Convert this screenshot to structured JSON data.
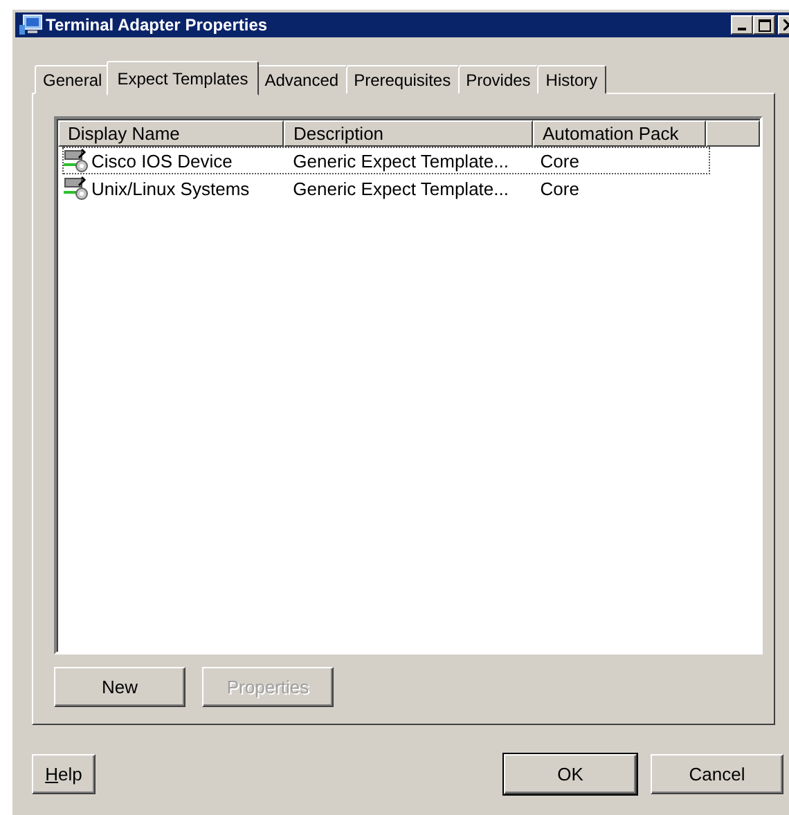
{
  "window": {
    "title": "Terminal Adapter Properties"
  },
  "tabs": [
    {
      "label": "General",
      "selected": false
    },
    {
      "label": "Expect Templates",
      "selected": true
    },
    {
      "label": "Advanced",
      "selected": false
    },
    {
      "label": "Prerequisites",
      "selected": false
    },
    {
      "label": "Provides",
      "selected": false
    },
    {
      "label": "History",
      "selected": false
    }
  ],
  "table": {
    "columns": [
      "Display Name",
      "Description",
      "Automation Pack"
    ],
    "rows": [
      {
        "cells": [
          "Cisco IOS Device",
          "Generic Expect Template...",
          "Core"
        ],
        "focused": true
      },
      {
        "cells": [
          "Unix/Linux Systems",
          "Generic Expect Template...",
          "Core"
        ],
        "focused": false
      }
    ]
  },
  "panel_buttons": [
    {
      "label": "New",
      "disabled": false
    },
    {
      "label": "Properties",
      "disabled": true
    }
  ],
  "dialog_buttons": [
    {
      "label": "Help",
      "kind": "help",
      "default": false
    },
    {
      "label": "OK",
      "kind": "ok",
      "default": true
    },
    {
      "label": "Cancel",
      "kind": "cancel",
      "default": false
    }
  ]
}
